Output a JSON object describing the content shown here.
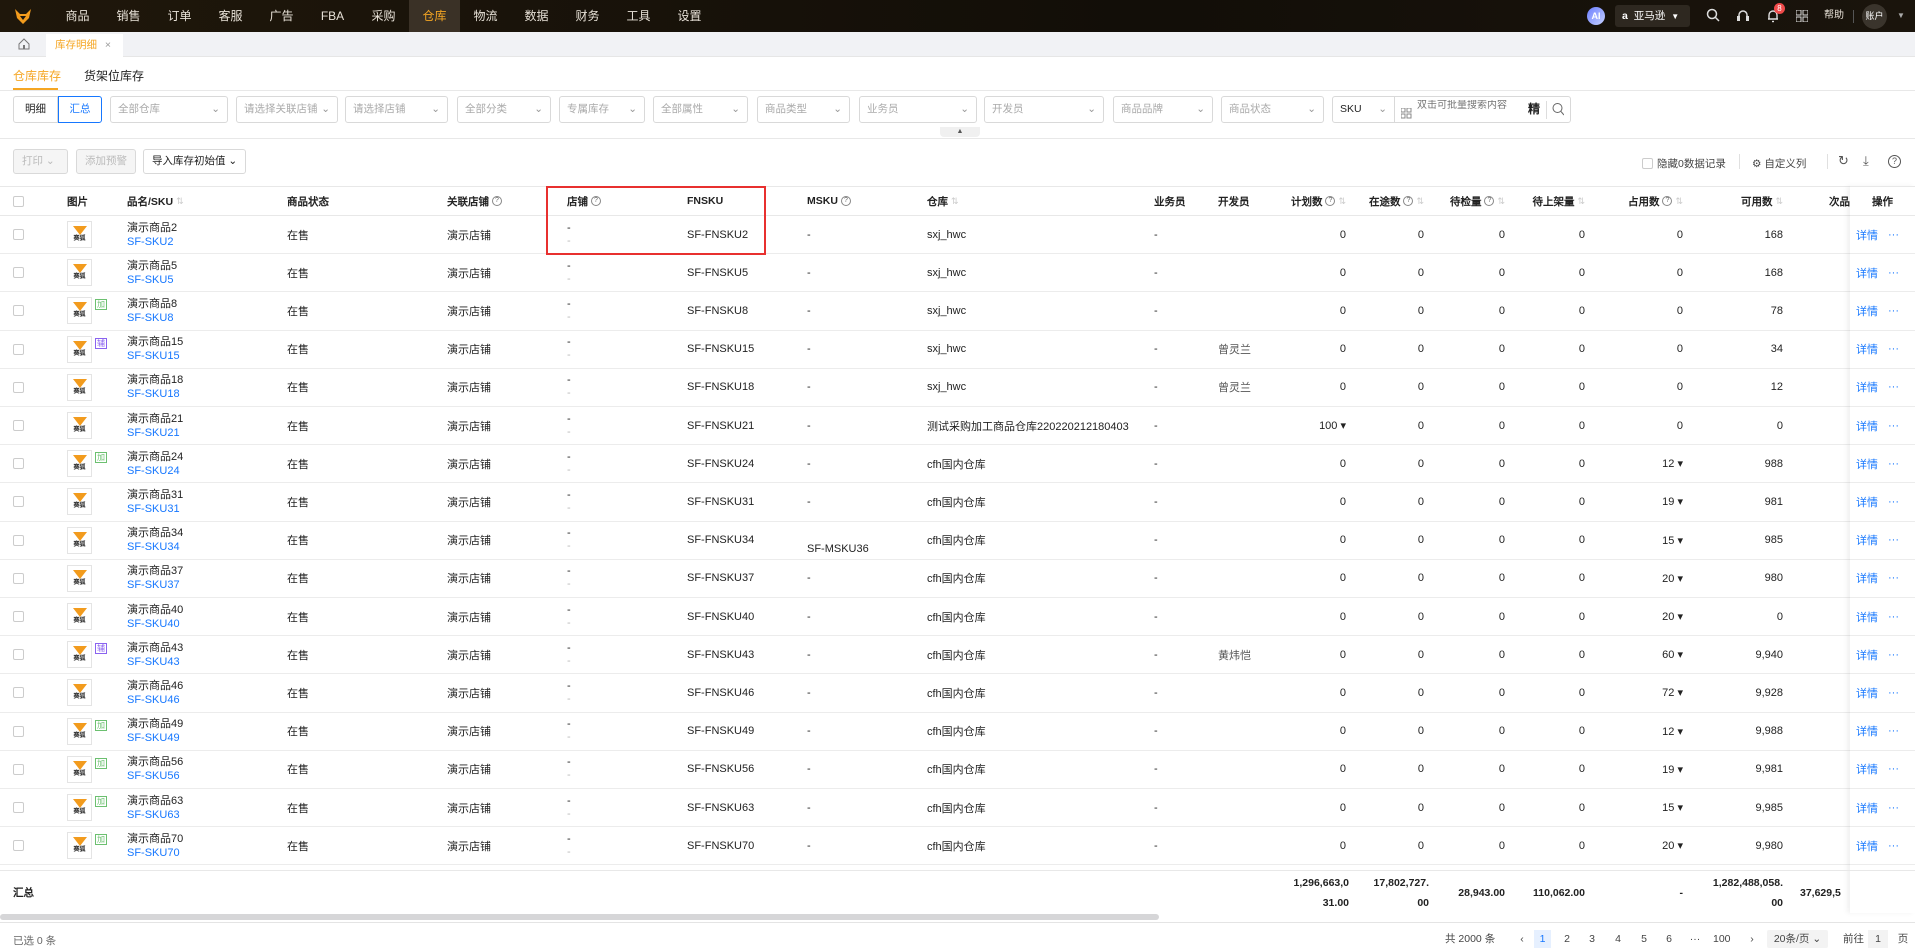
{
  "nav": {
    "items": [
      "商品",
      "销售",
      "订单",
      "客服",
      "广告",
      "FBA",
      "采购",
      "仓库",
      "物流",
      "数据",
      "财务",
      "工具",
      "设置"
    ],
    "active": "仓库",
    "ai_label": "AI",
    "platform": "亚马逊",
    "help": "帮助",
    "account": "账户",
    "notification_count": "8"
  },
  "tabs": {
    "open_tab": "库存明细",
    "close": "×"
  },
  "subtabs": [
    "仓库库存",
    "货架位库存"
  ],
  "filters": {
    "view_toggle": [
      "明细",
      "汇总"
    ],
    "selects": [
      "全部仓库",
      "请选择关联店铺",
      "请选择店铺",
      "全部分类",
      "专属库存",
      "全部属性",
      "商品类型",
      "业务员",
      "开发员",
      "商品品牌",
      "商品状态"
    ],
    "search_field": "SKU",
    "search_placeholder": "双击可批量搜索内容",
    "exact_label": "精"
  },
  "toolbar": {
    "print": "打印",
    "add_alert": "添加预警",
    "import_initial": "导入库存初始值",
    "hide_zero": "隐藏0数据记录",
    "custom_columns": "自定义列"
  },
  "columns": [
    "图片",
    "品名/SKU",
    "商品状态",
    "关联店铺",
    "店铺",
    "FNSKU",
    "MSKU",
    "仓库",
    "业务员",
    "开发员",
    "计划数",
    "在途数",
    "待检量",
    "待上架量",
    "占用数",
    "可用数",
    "次品",
    "操作"
  ],
  "thumb_logo": "赛狐",
  "rows": [
    {
      "name": "演示商品2",
      "sku": "SF-SKU2",
      "status": "在售",
      "linked_shop": "演示店铺",
      "shop": "-",
      "shop2": "-",
      "fnsku": "SF-FNSKU2",
      "msku": "-",
      "warehouse": "sxj_hwc",
      "sales": "-",
      "dev": "",
      "plan": "0",
      "transit": "0",
      "inspect": "0",
      "shelve": "0",
      "occupied": "0",
      "available": "168",
      "badge": ""
    },
    {
      "name": "演示商品5",
      "sku": "SF-SKU5",
      "status": "在售",
      "linked_shop": "演示店铺",
      "shop": "-",
      "shop2": "-",
      "fnsku": "SF-FNSKU5",
      "msku": "-",
      "warehouse": "sxj_hwc",
      "sales": "-",
      "dev": "",
      "plan": "0",
      "transit": "0",
      "inspect": "0",
      "shelve": "0",
      "occupied": "0",
      "available": "168",
      "badge": ""
    },
    {
      "name": "演示商品8",
      "sku": "SF-SKU8",
      "status": "在售",
      "linked_shop": "演示店铺",
      "shop": "-",
      "shop2": "-",
      "fnsku": "SF-FNSKU8",
      "msku": "-",
      "warehouse": "sxj_hwc",
      "sales": "-",
      "dev": "",
      "plan": "0",
      "transit": "0",
      "inspect": "0",
      "shelve": "0",
      "occupied": "0",
      "available": "78",
      "badge": "加"
    },
    {
      "name": "演示商品15",
      "sku": "SF-SKU15",
      "status": "在售",
      "linked_shop": "演示店铺",
      "shop": "-",
      "shop2": "-",
      "fnsku": "SF-FNSKU15",
      "msku": "-",
      "warehouse": "sxj_hwc",
      "sales": "-",
      "dev": "曾灵兰",
      "plan": "0",
      "transit": "0",
      "inspect": "0",
      "shelve": "0",
      "occupied": "0",
      "available": "34",
      "badge": "辅"
    },
    {
      "name": "演示商品18",
      "sku": "SF-SKU18",
      "status": "在售",
      "linked_shop": "演示店铺",
      "shop": "-",
      "shop2": "-",
      "fnsku": "SF-FNSKU18",
      "msku": "-",
      "warehouse": "sxj_hwc",
      "sales": "-",
      "dev": "曾灵兰",
      "plan": "0",
      "transit": "0",
      "inspect": "0",
      "shelve": "0",
      "occupied": "0",
      "available": "12",
      "badge": ""
    },
    {
      "name": "演示商品21",
      "sku": "SF-SKU21",
      "status": "在售",
      "linked_shop": "演示店铺",
      "shop": "-",
      "shop2": "-",
      "fnsku": "SF-FNSKU21",
      "msku": "-",
      "warehouse": "测试采购加工商品仓库220220212180403",
      "sales": "-",
      "dev": "",
      "plan": "100 ▾",
      "transit": "0",
      "inspect": "0",
      "shelve": "0",
      "occupied": "0",
      "available": "0",
      "badge": ""
    },
    {
      "name": "演示商品24",
      "sku": "SF-SKU24",
      "status": "在售",
      "linked_shop": "演示店铺",
      "shop": "-",
      "shop2": "-",
      "fnsku": "SF-FNSKU24",
      "msku": "-",
      "warehouse": "cfh国内仓库",
      "sales": "-",
      "dev": "",
      "plan": "0",
      "transit": "0",
      "inspect": "0",
      "shelve": "0",
      "occupied": "12 ▾",
      "available": "988",
      "badge": "加"
    },
    {
      "name": "演示商品31",
      "sku": "SF-SKU31",
      "status": "在售",
      "linked_shop": "演示店铺",
      "shop": "-",
      "shop2": "-",
      "fnsku": "SF-FNSKU31",
      "msku": "-",
      "warehouse": "cfh国内仓库",
      "sales": "-",
      "dev": "",
      "plan": "0",
      "transit": "0",
      "inspect": "0",
      "shelve": "0",
      "occupied": "19 ▾",
      "available": "981",
      "badge": ""
    },
    {
      "name": "演示商品34",
      "sku": "SF-SKU34",
      "status": "在售",
      "linked_shop": "演示店铺",
      "shop": "-",
      "shop2": "-",
      "fnsku": "SF-FNSKU34",
      "msku": "SF-MSKU36",
      "warehouse": "cfh国内仓库",
      "sales": "-",
      "dev": "",
      "plan": "0",
      "transit": "0",
      "inspect": "0",
      "shelve": "0",
      "occupied": "15 ▾",
      "available": "985",
      "badge": ""
    },
    {
      "name": "演示商品37",
      "sku": "SF-SKU37",
      "status": "在售",
      "linked_shop": "演示店铺",
      "shop": "-",
      "shop2": "-",
      "fnsku": "SF-FNSKU37",
      "msku": "-",
      "warehouse": "cfh国内仓库",
      "sales": "-",
      "dev": "",
      "plan": "0",
      "transit": "0",
      "inspect": "0",
      "shelve": "0",
      "occupied": "20 ▾",
      "available": "980",
      "badge": ""
    },
    {
      "name": "演示商品40",
      "sku": "SF-SKU40",
      "status": "在售",
      "linked_shop": "演示店铺",
      "shop": "-",
      "shop2": "-",
      "fnsku": "SF-FNSKU40",
      "msku": "-",
      "warehouse": "cfh国内仓库",
      "sales": "-",
      "dev": "",
      "plan": "0",
      "transit": "0",
      "inspect": "0",
      "shelve": "0",
      "occupied": "20 ▾",
      "available": "0",
      "badge": ""
    },
    {
      "name": "演示商品43",
      "sku": "SF-SKU43",
      "status": "在售",
      "linked_shop": "演示店铺",
      "shop": "-",
      "shop2": "-",
      "fnsku": "SF-FNSKU43",
      "msku": "-",
      "warehouse": "cfh国内仓库",
      "sales": "-",
      "dev": "黄炜恺",
      "plan": "0",
      "transit": "0",
      "inspect": "0",
      "shelve": "0",
      "occupied": "60 ▾",
      "available": "9,940",
      "badge": "辅"
    },
    {
      "name": "演示商品46",
      "sku": "SF-SKU46",
      "status": "在售",
      "linked_shop": "演示店铺",
      "shop": "-",
      "shop2": "-",
      "fnsku": "SF-FNSKU46",
      "msku": "-",
      "warehouse": "cfh国内仓库",
      "sales": "-",
      "dev": "",
      "plan": "0",
      "transit": "0",
      "inspect": "0",
      "shelve": "0",
      "occupied": "72 ▾",
      "available": "9,928",
      "badge": ""
    },
    {
      "name": "演示商品49",
      "sku": "SF-SKU49",
      "status": "在售",
      "linked_shop": "演示店铺",
      "shop": "-",
      "shop2": "-",
      "fnsku": "SF-FNSKU49",
      "msku": "-",
      "warehouse": "cfh国内仓库",
      "sales": "-",
      "dev": "",
      "plan": "0",
      "transit": "0",
      "inspect": "0",
      "shelve": "0",
      "occupied": "12 ▾",
      "available": "9,988",
      "badge": "加"
    },
    {
      "name": "演示商品56",
      "sku": "SF-SKU56",
      "status": "在售",
      "linked_shop": "演示店铺",
      "shop": "-",
      "shop2": "-",
      "fnsku": "SF-FNSKU56",
      "msku": "-",
      "warehouse": "cfh国内仓库",
      "sales": "-",
      "dev": "",
      "plan": "0",
      "transit": "0",
      "inspect": "0",
      "shelve": "0",
      "occupied": "19 ▾",
      "available": "9,981",
      "badge": "加"
    },
    {
      "name": "演示商品63",
      "sku": "SF-SKU63",
      "status": "在售",
      "linked_shop": "演示店铺",
      "shop": "-",
      "shop2": "-",
      "fnsku": "SF-FNSKU63",
      "msku": "-",
      "warehouse": "cfh国内仓库",
      "sales": "-",
      "dev": "",
      "plan": "0",
      "transit": "0",
      "inspect": "0",
      "shelve": "0",
      "occupied": "15 ▾",
      "available": "9,985",
      "badge": "加"
    },
    {
      "name": "演示商品70",
      "sku": "SF-SKU70",
      "status": "在售",
      "linked_shop": "演示店铺",
      "shop": "-",
      "shop2": "-",
      "fnsku": "SF-FNSKU70",
      "msku": "-",
      "warehouse": "cfh国内仓库",
      "sales": "-",
      "dev": "",
      "plan": "0",
      "transit": "0",
      "inspect": "0",
      "shelve": "0",
      "occupied": "20 ▾",
      "available": "9,980",
      "badge": "加"
    }
  ],
  "row_actions": {
    "detail": "详情",
    "more": "···"
  },
  "summary": {
    "label": "汇总",
    "plan": [
      "1,296,663,0",
      "31.00"
    ],
    "transit": [
      "17,802,727.",
      "00"
    ],
    "inspect": "28,943.00",
    "shelve": "110,062.00",
    "occupied": "-",
    "available": [
      "1,282,488,058.",
      "00"
    ],
    "defective": "37,629,5"
  },
  "footer": {
    "selected": "已选 0 条",
    "total": "共 2000 条",
    "pages": [
      "1",
      "2",
      "3",
      "4",
      "5",
      "6",
      "···",
      "100"
    ],
    "current_page": "1",
    "page_size": "20条/页",
    "goto": "前往",
    "goto_value": "1",
    "page_unit": "页"
  },
  "colors": {
    "accent": "#f5a623",
    "link": "#1677ff",
    "highlight_box": "#e8302f",
    "badge_add": "#6cc070",
    "badge_aux": "#8a63f0"
  }
}
